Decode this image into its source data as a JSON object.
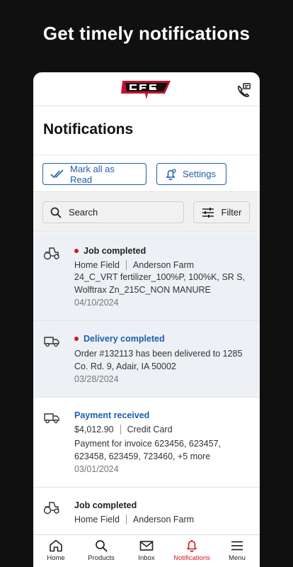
{
  "promo": {
    "headline": "Get timely notifications"
  },
  "page": {
    "title": "Notifications"
  },
  "actions": {
    "mark_all": "Mark all as Read",
    "settings": "Settings"
  },
  "search": {
    "placeholder": "Search",
    "filter": "Filter"
  },
  "notifications": [
    {
      "title": "Job completed",
      "unread": true,
      "meta_left": "Home Field",
      "meta_right": "Anderson Farm",
      "body": "24_C_VRT fertilizer_100%P, 100%K, SR S, Wolftrax Zn_215C_NON MANURE",
      "date": "04/10/2024",
      "icon": "tractor-icon"
    },
    {
      "title": "Delivery completed",
      "unread": true,
      "body": "Order #132113 has been delivered to 1285 Co. Rd. 9, Adair, IA 50002",
      "date": "03/28/2024",
      "icon": "truck-icon"
    },
    {
      "title": "Payment received",
      "unread": false,
      "meta_left": "$4,012.90",
      "meta_right": "Credit Card",
      "body": "Payment for invoice 623456, 623457, 623458, 623459, 723460, +5 more",
      "date": "03/01/2024",
      "icon": "truck-icon"
    },
    {
      "title": "Job completed",
      "unread": false,
      "meta_left": "Home Field",
      "meta_right": "Anderson Farm",
      "icon": "tractor-icon"
    }
  ],
  "tabs": [
    {
      "label": "Home",
      "icon": "home-icon"
    },
    {
      "label": "Products",
      "icon": "search-icon"
    },
    {
      "label": "Inbox",
      "icon": "mail-icon"
    },
    {
      "label": "Notifications",
      "icon": "bell-icon",
      "active": true
    },
    {
      "label": "Menu",
      "icon": "menu-icon"
    }
  ],
  "colors": {
    "accent": "#d21a1a",
    "link": "#1f5fa8",
    "unread_bg": "#edf1f5"
  }
}
